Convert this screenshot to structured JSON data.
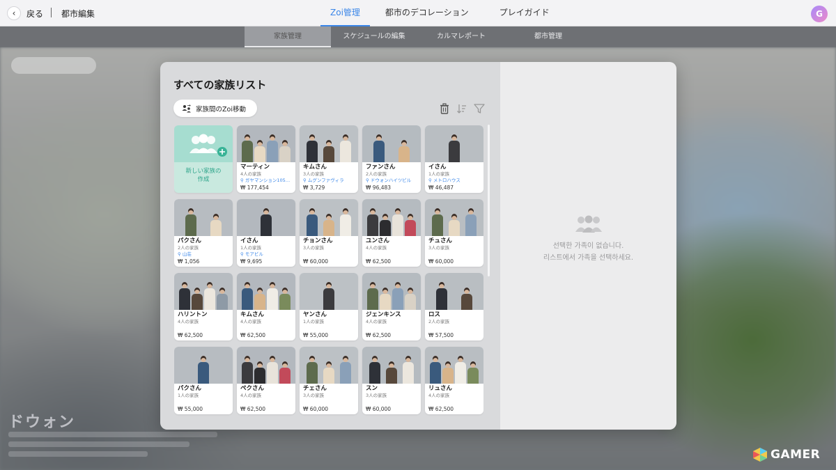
{
  "header": {
    "back_label": "戻る",
    "page_title": "都市編集",
    "tabs": [
      {
        "label": "Zoi管理",
        "active": true
      },
      {
        "label": "都市のデコレーション",
        "active": false
      },
      {
        "label": "プレイガイド",
        "active": false
      }
    ],
    "avatar_letter": "G"
  },
  "subnav": {
    "tabs": [
      {
        "label": "家族管理",
        "active": true
      },
      {
        "label": "スケジュールの編集",
        "active": false
      },
      {
        "label": "カルマレポート",
        "active": false
      },
      {
        "label": "都市管理",
        "active": false
      }
    ]
  },
  "background": {
    "district_name": "ドウォン"
  },
  "modal": {
    "title": "すべての家族リスト",
    "move_button_label": "家族間のZoi移動",
    "toolbar_icons": [
      "trash-icon",
      "sort-icon",
      "filter-icon"
    ],
    "new_family_label": [
      "新しい家族の",
      "作成"
    ],
    "families": [
      {
        "name": "マーティン",
        "count": "4人の家族",
        "location": "ガヤマンション105…",
        "price": "₩ 177,454"
      },
      {
        "name": "キムさん",
        "count": "3人の家族",
        "location": "ムグンファヴィラ",
        "price": "₩ 3,729"
      },
      {
        "name": "ファンさん",
        "count": "2人の家族",
        "location": "ドウォンハイツビル",
        "price": "₩ 96,483"
      },
      {
        "name": "イさん",
        "count": "1人の家族",
        "location": "メトロハウス",
        "price": "₩ 46,487"
      },
      {
        "name": "パクさん",
        "count": "2人の家族",
        "location": "山荘",
        "price": "₩ 1,056"
      },
      {
        "name": "イさん",
        "count": "1人の家族",
        "location": "モアビル",
        "price": "₩ 9,695"
      },
      {
        "name": "チョンさん",
        "count": "3人の家族",
        "location": "",
        "price": "₩ 60,000"
      },
      {
        "name": "ユンさん",
        "count": "4人の家族",
        "location": "",
        "price": "₩ 62,500"
      },
      {
        "name": "チュさん",
        "count": "3人の家族",
        "location": "",
        "price": "₩ 60,000"
      },
      {
        "name": "ハリントン",
        "count": "4人の家族",
        "location": "",
        "price": "₩ 62,500"
      },
      {
        "name": "キムさん",
        "count": "4人の家族",
        "location": "",
        "price": "₩ 62,500"
      },
      {
        "name": "ヤンさん",
        "count": "1人の家族",
        "location": "",
        "price": "₩ 55,000"
      },
      {
        "name": "ジェンキンス",
        "count": "4人の家族",
        "location": "",
        "price": "₩ 62,500"
      },
      {
        "name": "ロス",
        "count": "2人の家族",
        "location": "",
        "price": "₩ 57,500"
      },
      {
        "name": "パクさん",
        "count": "1人の家族",
        "location": "",
        "price": "₩ 55,000"
      },
      {
        "name": "ペクさん",
        "count": "4人の家族",
        "location": "",
        "price": "₩ 62,500"
      },
      {
        "name": "チェさん",
        "count": "3人の家族",
        "location": "",
        "price": "₩ 60,000"
      },
      {
        "name": "スン",
        "count": "3人の家族",
        "location": "",
        "price": "₩ 60,000"
      },
      {
        "name": "リュさん",
        "count": "4人の家族",
        "location": "",
        "price": "₩ 62,500"
      }
    ],
    "empty_state": {
      "line1": "선택한 가족이 없습니다.",
      "line2": "리스트에서 가족을 선택하세요."
    }
  },
  "watermark": {
    "text": "GAMER"
  },
  "colors": {
    "accent": "#3a86e8",
    "new_family": "#2ea58b"
  }
}
